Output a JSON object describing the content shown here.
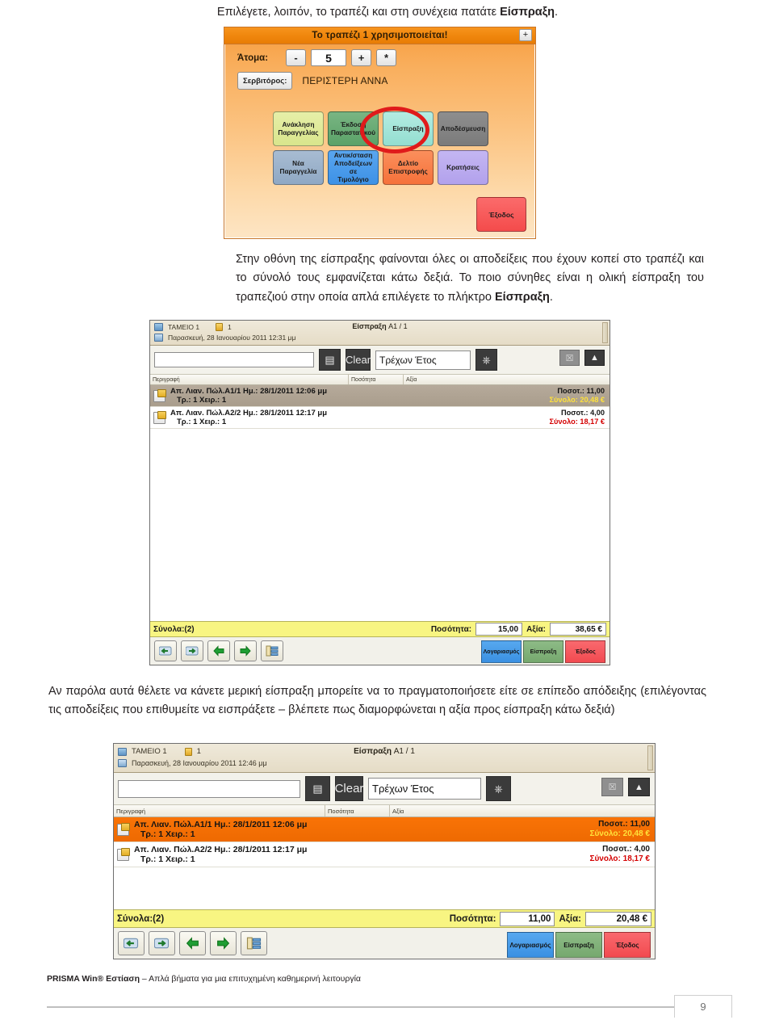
{
  "document": {
    "intro_paragraph_prefix": "Επιλέγετε, λοιπόν, το τραπέζι και στη συνέχεια πατάτε ",
    "intro_paragraph_bold": "Είσπραξη",
    "intro_paragraph_suffix": ".",
    "mid_paragraph_part1": "Στην οθόνη της είσπραξης φαίνονται όλες οι αποδείξεις που έχουν κοπεί στο τραπέζι και το σύνολό τους εμφανίζεται κάτω δεξιά. Το ποιο σύνηθες είναι η ολική είσπραξη του τραπεζιού στην οποία απλά επιλέγετε το πλήκτρο ",
    "mid_paragraph_bold": "Είσπραξη",
    "mid_paragraph_part2": ".",
    "bottom_paragraph": "Αν παρόλα αυτά θέλετε να κάνετε μερική είσπραξη μπορείτε να το πραγματοποιήσετε είτε σε επίπεδο απόδειξης (επιλέγοντας τις αποδείξεις που επιθυμείτε να εισπράξετε – βλέπετε πως διαμορφώνεται η αξία προς είσπραξη κάτω δεξιά)",
    "footer_bold": "PRISMA Win® Εστίαση",
    "footer_rest": " – Απλά βήματα για μια επιτυχημένη καθημερινή λειτουργία",
    "page_number": "9"
  },
  "pos_panel": {
    "title": "Το τραπέζι 1 χρησιμοποιείται!",
    "plus_button": "+",
    "people_label": "Άτομα:",
    "minus_button": "-",
    "people_value": "5",
    "plus_people_button": "+",
    "star_button": "*",
    "waiter_button": "Σερβιτόρος:",
    "waiter_name": "ΠΕΡΙΣΤΕΡΗ ΑΝΝΑ",
    "keys": [
      {
        "label": "Ανάκληση\nΠαραγγελίας",
        "color": "#d9e58c"
      },
      {
        "label": "Έκδοση\nΠαραστατικού",
        "color": "#5ba268"
      },
      {
        "label": "Είσπραξη",
        "color": "#93ded0"
      },
      {
        "label": "Αποδέσμευση",
        "color": "#7b7b7b"
      },
      {
        "label": "Νέα\nΠαραγγελία",
        "color": "#8fa8c4"
      },
      {
        "label": "Αντικ/σταση\nΑποδείξεων σε\nΤιμολόγιο",
        "color": "#3d91e6"
      },
      {
        "label": "Δελτίο\nΕπιστροφής",
        "color": "#f5713a"
      },
      {
        "label": "Κρατήσεις",
        "color": "#b2a1ec"
      }
    ],
    "exit_button": "Έξοδος",
    "annotation_color": "#e01b1b"
  },
  "window_full": {
    "header": {
      "register": "ΤΑΜΕΙΟ 1",
      "lock_number": "1",
      "title_bold": "Είσπραξη",
      "title_rest": " A1 / 1",
      "date": "Παρασκευή, 28 Ιανουαρίου 2011 12:31 μμ"
    },
    "toolbar": {
      "search_value": "",
      "search_placeholder": "",
      "print_icon": "printer-icon",
      "clear_button": "Clear",
      "year_filter": "Τρέχων Έτος",
      "power_icon": "power-icon",
      "close_icon": "x-box-icon",
      "image_icon": "image-box-icon"
    },
    "columns": [
      "Περιγραφή",
      "Ποσότητα",
      "Αξία"
    ],
    "rows": [
      {
        "line1": "Απ. Λιαν. Πώλ.Α1/1 Ημ.: 28/1/2011 12:06 μμ",
        "line2": "Τρ.: 1 Χειρ.: 1",
        "qty": "Ποσοτ.: 11,00",
        "total": "Σύνολο: 20,48 €",
        "selected": true
      },
      {
        "line1": "Απ. Λιαν. Πώλ.Α2/2 Ημ.: 28/1/2011 12:17 μμ",
        "line2": "Τρ.: 1 Χειρ.: 1",
        "qty": "Ποσοτ.: 4,00",
        "total": "Σύνολο: 18,17 €",
        "selected": false
      }
    ],
    "totals": {
      "label": "Σύνολα:(2)",
      "qty_label": "Ποσότητα:",
      "qty_value": "15,00",
      "value_label": "Αξία:",
      "value_value": "38,65 €"
    },
    "actions": {
      "logariasmos": "Λογαριασμός",
      "eispraxi": "Είσπραξη",
      "exodos": "Έξοδος"
    }
  },
  "window_partial": {
    "header": {
      "register": "ΤΑΜΕΙΟ 1",
      "lock_number": "1",
      "title_bold": "Είσπραξη",
      "title_rest": " A1 / 1",
      "date": "Παρασκευή, 28 Ιανουαρίου 2011 12:46 μμ"
    },
    "toolbar": {
      "search_value": "",
      "search_placeholder": "",
      "print_icon": "printer-icon",
      "clear_button": "Clear",
      "year_filter": "Τρέχων Έτος",
      "power_icon": "power-icon",
      "close_icon": "x-box-icon",
      "image_icon": "image-box-icon"
    },
    "columns": [
      "Περιγραφή",
      "Ποσότητα",
      "Αξία"
    ],
    "rows": [
      {
        "line1": "Απ. Λιαν. Πώλ.Α1/1 Ημ.: 28/1/2011 12:06 μμ",
        "line2": "Τρ.: 1 Χειρ.: 1",
        "qty": "Ποσοτ.: 11,00",
        "total": "Σύνολο: 20,48 €",
        "selected": true
      },
      {
        "line1": "Απ. Λιαν. Πώλ.Α2/2 Ημ.: 28/1/2011 12:17 μμ",
        "line2": "Τρ.: 1 Χειρ.: 1",
        "qty": "Ποσοτ.: 4,00",
        "total": "Σύνολο: 18,17 €",
        "selected": false
      }
    ],
    "totals": {
      "label": "Σύνολα:(2)",
      "qty_label": "Ποσότητα:",
      "qty_value": "11,00",
      "value_label": "Αξία:",
      "value_value": "20,48 €"
    },
    "actions": {
      "logariasmos": "Λογαριασμός",
      "eispraxi": "Είσπραξη",
      "exodos": "Έξοδος"
    }
  }
}
